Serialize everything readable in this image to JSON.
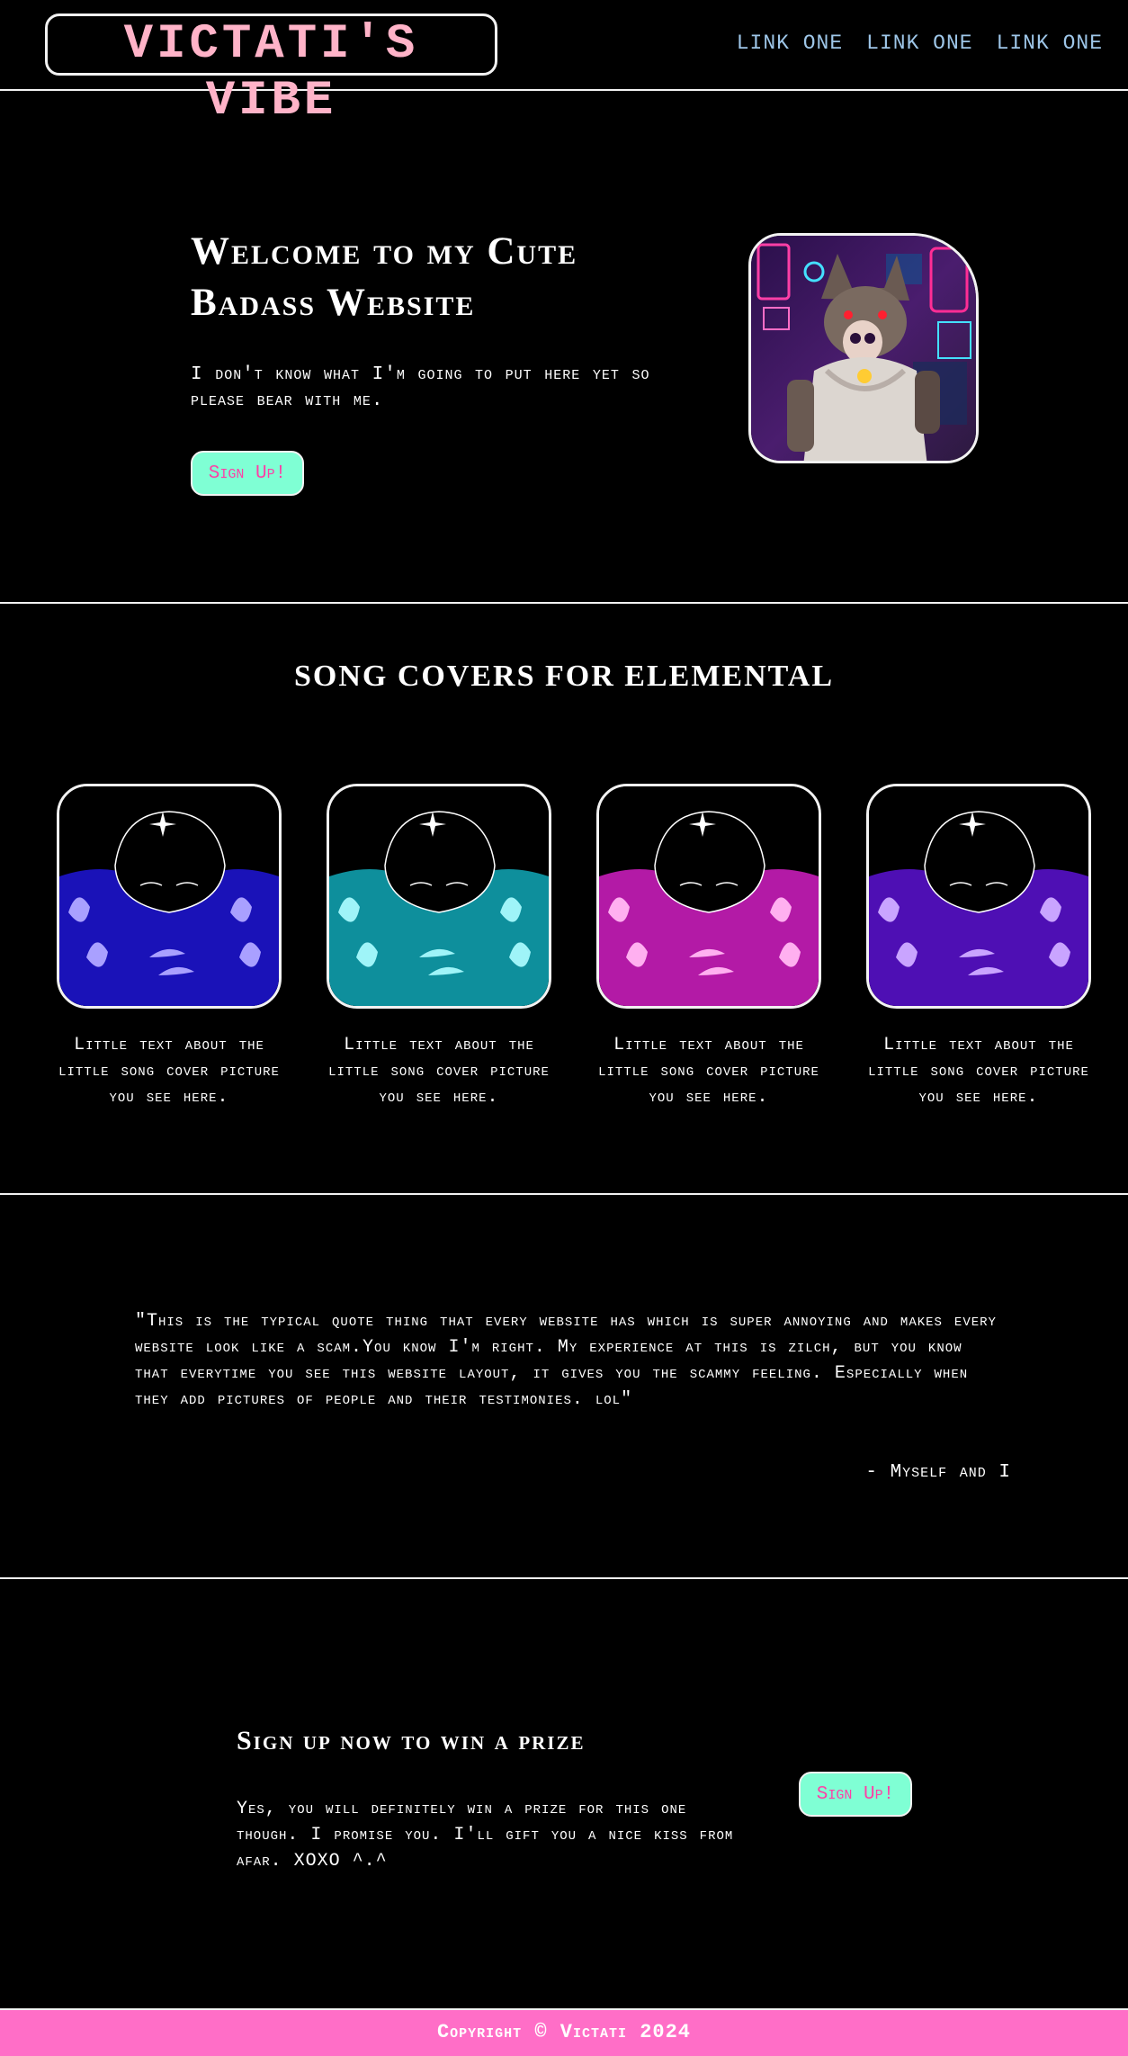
{
  "header": {
    "logo": "VICTATI'S VIBE",
    "nav": [
      "LINK ONE",
      "LINK ONE",
      "LINK ONE"
    ]
  },
  "hero": {
    "title": "Welcome to my Cute Badass Website",
    "text": "I don't know what I'm going to put here yet so please bear with me.",
    "button": "Sign Up!"
  },
  "covers": {
    "title": "SONG COVERS FOR ELEMENTAL",
    "items": [
      {
        "caption": "Little text about the little song cover picture you see here.",
        "color": "#1a12b8"
      },
      {
        "caption": "Little text about the little song cover picture you see here.",
        "color": "#0e8f9c"
      },
      {
        "caption": "Little text about the little song cover picture you see here.",
        "color": "#b31aa6"
      },
      {
        "caption": "Little text about the little song cover picture you see here.",
        "color": "#4e0fb4"
      }
    ]
  },
  "quote": {
    "text": "\"This is the typical quote thing that every website has which is super annoying and makes every website look like a scam.You know I'm right. My experience at this is zilch, but you know that everytime you see this website layout, it gives you the scammy feeling. Especially when they add pictures of people and their testimonies. lol\"",
    "author": "- Myself and I"
  },
  "signup": {
    "title": "Sign up now to win a prize",
    "text": "Yes, you will definitely win a prize for this one though. I promise you. I'll gift you a nice kiss from afar. XOXO ^.^",
    "button": "Sign Up!"
  },
  "footer": {
    "text": "Copyright © Victati 2024"
  },
  "colors": {
    "logo": "#ffb3c8",
    "nav": "#9ec6e8",
    "button_bg": "#7fffd4",
    "button_text": "#ff3fa6",
    "footer_bg": "#ff6ec7"
  }
}
